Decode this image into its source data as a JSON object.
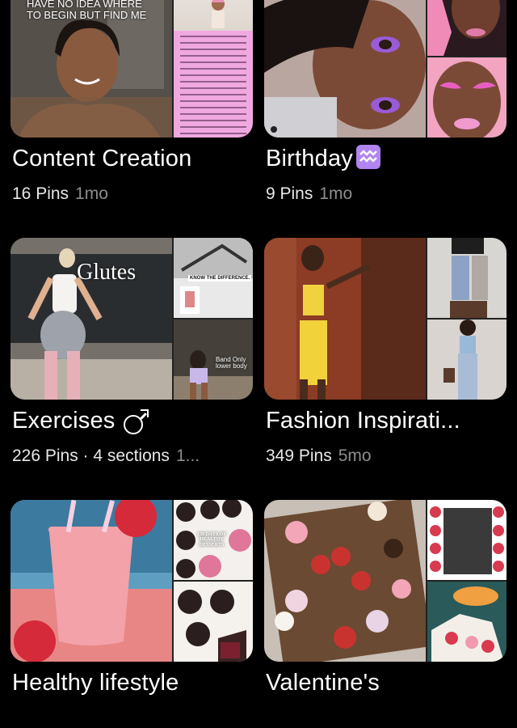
{
  "boards": [
    {
      "title": "Content Creation",
      "pins": "16 Pins",
      "time": "1mo",
      "overlay_text": "HAVE NO IDEA WHERE\nTO BEGIN BUT FIND ME",
      "icon": "none"
    },
    {
      "title": "Birthday",
      "pins": "9 Pins",
      "time": "1mo",
      "icon": "aquarius-icon"
    },
    {
      "title": "Exercises",
      "pins": "226 Pins · 4 sections",
      "time": "1...",
      "overlay_text": "Glutes",
      "sub_text_1": "KNOW THE DIFFERENCE.",
      "sub_text_2": "Band Only\nlower body",
      "icon": "male-sign-icon"
    },
    {
      "title": "Fashion Inspirati...",
      "pins": "349 Pins",
      "time": "5mo",
      "icon": "none"
    },
    {
      "title": "Healthy lifestyle",
      "pins": "",
      "time": "",
      "overlay_text": "150 DAYS OF HEALTHY DESSERTS",
      "icon": "none"
    },
    {
      "title": "Valentine's",
      "pins": "",
      "time": "",
      "icon": "none"
    }
  ],
  "colors": {
    "background": "#000000",
    "title": "#ffffff",
    "meta_count": "#e8e8e8",
    "meta_time": "#8d8d8d",
    "aquarius_badge": "#b185f0"
  }
}
